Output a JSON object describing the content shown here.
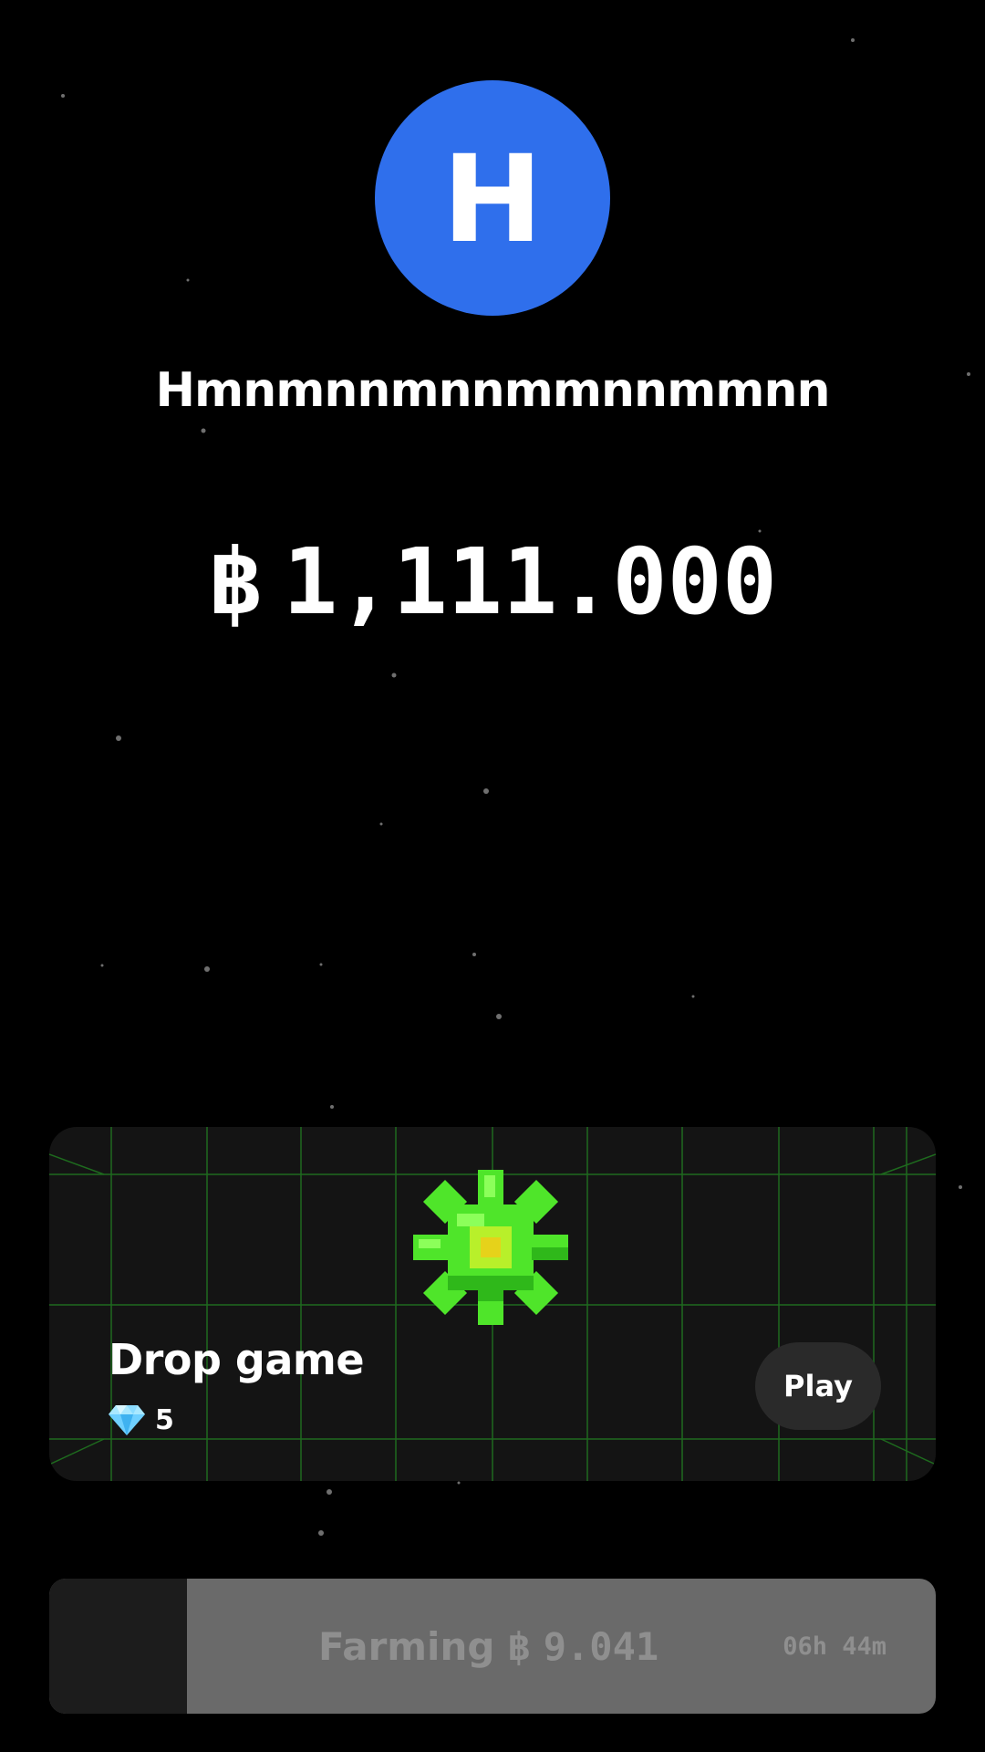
{
  "profile": {
    "avatar_letter": "H",
    "avatar_color": "#2f6fec",
    "username": "Hmnmnnmnnmmnnmmnn"
  },
  "balance": {
    "currency_symbol": "฿",
    "amount": "1,111.000"
  },
  "game_card": {
    "title": "Drop game",
    "cost_icon": "diamond-icon",
    "cost": "5",
    "play_label": "Play",
    "art_icon": "green-star-gem-icon",
    "accent_color": "#3cff2a"
  },
  "farming": {
    "label": "Farming",
    "currency_symbol": "฿",
    "amount": "9.041",
    "timer": "06h 44m",
    "progress": 0.155
  }
}
